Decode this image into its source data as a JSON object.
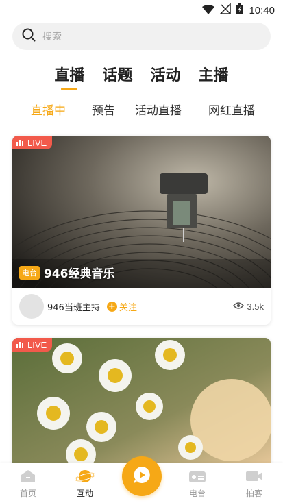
{
  "status_bar": {
    "time": "10:40"
  },
  "search": {
    "placeholder": "搜索"
  },
  "main_tabs": [
    {
      "label": "直播",
      "active": true
    },
    {
      "label": "话题",
      "active": false
    },
    {
      "label": "活动",
      "active": false
    },
    {
      "label": "主播",
      "active": false
    }
  ],
  "sub_tabs": [
    {
      "label": "直播中",
      "active": true
    },
    {
      "label": "预告",
      "active": false
    },
    {
      "label": "活动直播",
      "active": false
    },
    {
      "label": "网红直播",
      "active": false
    }
  ],
  "cards": [
    {
      "live_label": "LIVE",
      "tag": "电台",
      "title": "946经典音乐",
      "host": "946当班主持",
      "follow_label": "关注",
      "views": "3.5k"
    },
    {
      "live_label": "LIVE"
    }
  ],
  "bottom_nav": [
    {
      "label": "首页",
      "icon": "home-icon"
    },
    {
      "label": "互动",
      "icon": "planet-icon",
      "active": true
    },
    {
      "label": "",
      "icon": "play-chat-icon"
    },
    {
      "label": "电台",
      "icon": "radio-icon"
    },
    {
      "label": "拍客",
      "icon": "video-camera-icon"
    }
  ],
  "colors": {
    "accent": "#f6a816",
    "live": "#f25a4b"
  }
}
